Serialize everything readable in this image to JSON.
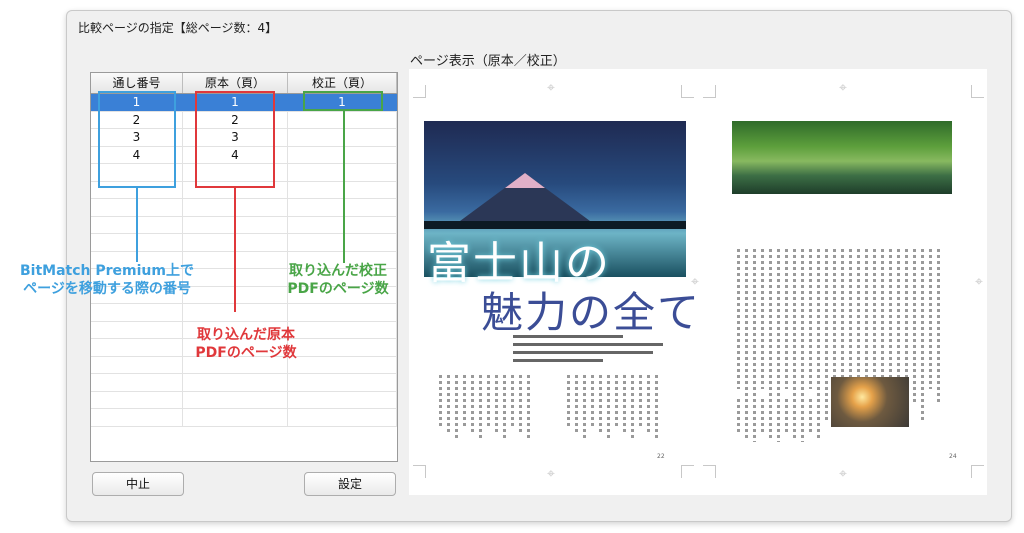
{
  "dialog": {
    "title": "比較ページの指定【総ページ数：4】",
    "preview_label": "ページ表示（原本／校正）"
  },
  "table": {
    "headers": [
      "通し番号",
      "原本（頁）",
      "校正（頁）"
    ],
    "rows": [
      [
        "1",
        "1",
        "1"
      ],
      [
        "2",
        "2",
        ""
      ],
      [
        "3",
        "3",
        ""
      ],
      [
        "4",
        "4",
        ""
      ]
    ],
    "selected_row": 0
  },
  "annotations": {
    "blue": [
      "BitMatch Premium上で",
      "ページを移動する際の番号"
    ],
    "green": [
      "取り込んだ校正",
      "PDFのページ数"
    ],
    "red": [
      "取り込んだ原本",
      "PDFのページ数"
    ]
  },
  "buttons": {
    "cancel": "中止",
    "set": "設定"
  },
  "preview": {
    "title_line1": "富士山の",
    "title_line2": "魅力の全て",
    "page_left": "22",
    "page_right": "24"
  },
  "colors": {
    "selection": "#3a80d6",
    "blue_note": "#3ea0de",
    "red_note": "#e0383b",
    "green_note": "#49a547"
  }
}
